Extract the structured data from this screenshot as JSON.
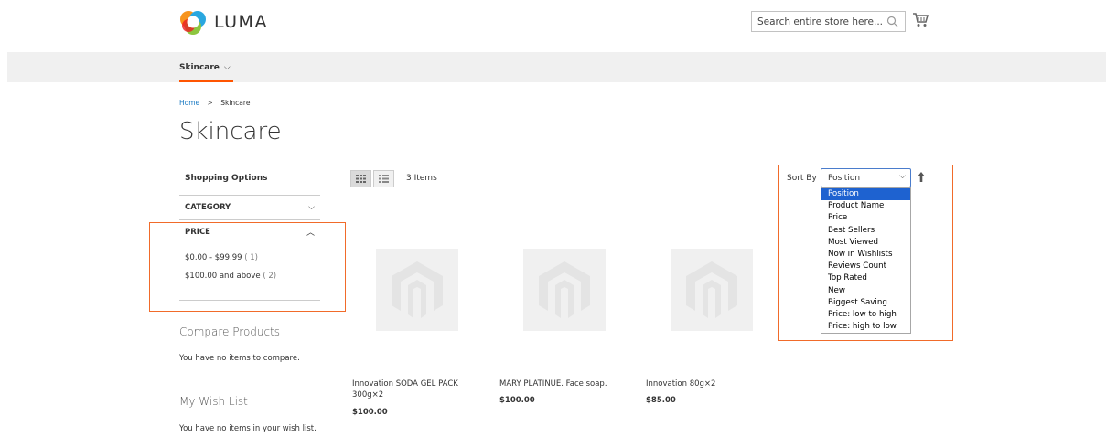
{
  "header": {
    "logo_text": "LUMA",
    "search_placeholder": "Search entire store here...",
    "icons": {
      "search": "search-icon",
      "cart": "cart-icon",
      "logo": "luma-logo-icon"
    }
  },
  "nav": {
    "items": [
      {
        "label": "Skincare",
        "icon": "chevron-down-icon"
      }
    ]
  },
  "breadcrumb": {
    "home": "Home",
    "separator": ">",
    "current": "Skincare"
  },
  "page_title": "Skincare",
  "sidebar": {
    "title": "Shopping Options",
    "filters": [
      {
        "label": "CATEGORY",
        "state": "collapsed",
        "icon": "chevron-down-icon"
      },
      {
        "label": "PRICE",
        "state": "expanded",
        "icon": "chevron-up-icon"
      }
    ],
    "price_options": [
      {
        "label": "$0.00 - $99.99",
        "count": "( 1)"
      },
      {
        "label": "$100.00 and above",
        "count": "( 2)"
      }
    ],
    "compare": {
      "title": "Compare Products",
      "text": "You have no items to compare."
    },
    "wishlist": {
      "title": "My Wish List",
      "text": "You have no items in your wish list."
    }
  },
  "toolbar": {
    "item_count": "3 Items",
    "sort_label": "Sort By",
    "sort_selected": "Position",
    "sort_options": [
      "Position",
      "Product Name",
      "Price",
      "Best Sellers",
      "Most Viewed",
      "Now in Wishlists",
      "Reviews Count",
      "Top Rated",
      "New",
      "Biggest Saving",
      "Price: low to high",
      "Price: high to low"
    ],
    "modes": [
      "grid-view-icon",
      "list-view-icon"
    ]
  },
  "products": [
    {
      "name_line1": "Innovation SODA GEL PACK",
      "name_line2": "300g×2",
      "price": "$100.00"
    },
    {
      "name_line1": "MARY PLATINUE. Face soap.",
      "name_line2": "",
      "price": "$100.00"
    },
    {
      "name_line1": "Innovation 80g×2",
      "name_line2": "",
      "price": "$85.00"
    }
  ],
  "colors": {
    "accent": "#ff5501",
    "highlight_border": "#f16b2a",
    "link": "#1979c3",
    "selected_option": "#1e62d0"
  }
}
